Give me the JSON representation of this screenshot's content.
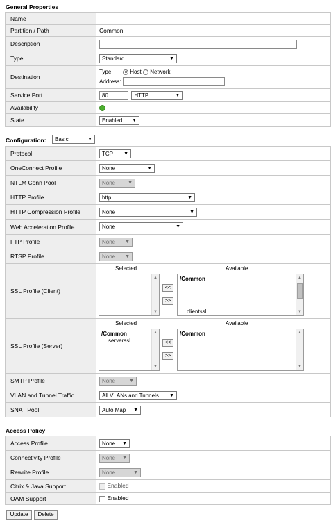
{
  "general": {
    "title": "General Properties",
    "name_label": "Name",
    "partition_label": "Partition / Path",
    "partition_value": "Common",
    "description_label": "Description",
    "type_label": "Type",
    "type_value": "Standard",
    "destination_label": "Destination",
    "dest_type_label": "Type:",
    "dest_host": "Host",
    "dest_network": "Network",
    "dest_address_label": "Address:",
    "service_port_label": "Service Port",
    "service_port_value": "80",
    "service_port_protocol": "HTTP",
    "availability_label": "Availability",
    "state_label": "State",
    "state_value": "Enabled"
  },
  "configuration": {
    "title": "Configuration:",
    "mode": "Basic",
    "protocol_label": "Protocol",
    "protocol_value": "TCP",
    "oneconnect_label": "OneConnect Profile",
    "oneconnect_value": "None",
    "ntlm_label": "NTLM Conn Pool",
    "ntlm_value": "None",
    "http_profile_label": "HTTP Profile",
    "http_profile_value": "http",
    "http_compression_label": "HTTP Compression Profile",
    "http_compression_value": "None",
    "web_accel_label": "Web Acceleration Profile",
    "web_accel_value": "None",
    "ftp_label": "FTP Profile",
    "ftp_value": "None",
    "rtsp_label": "RTSP Profile",
    "rtsp_value": "None",
    "ssl_client_label": "SSL Profile (Client)",
    "ssl_server_label": "SSL Profile (Server)",
    "selected_header": "Selected",
    "available_header": "Available",
    "move_left": "<<",
    "move_right": ">>",
    "ssl_client_available_group": "/Common",
    "ssl_client_available_item": "clientssl",
    "ssl_server_selected_group": "/Common",
    "ssl_server_selected_item": "serverssl",
    "ssl_server_available_group": "/Common",
    "smtp_label": "SMTP Profile",
    "smtp_value": "None",
    "vlan_label": "VLAN and Tunnel Traffic",
    "vlan_value": "All VLANs and Tunnels",
    "snat_label": "SNAT Pool",
    "snat_value": "Auto Map"
  },
  "access": {
    "title": "Access Policy",
    "access_profile_label": "Access Profile",
    "access_profile_value": "None",
    "connectivity_label": "Connectivity Profile",
    "connectivity_value": "None",
    "rewrite_label": "Rewrite Profile",
    "rewrite_value": "None",
    "citrix_label": "Citrix & Java Support",
    "citrix_value": "Enabled",
    "oam_label": "OAM Support",
    "oam_value": "Enabled"
  },
  "buttons": {
    "update": "Update",
    "delete": "Delete"
  },
  "colors": {
    "label_bg": "#eeeeee",
    "border": "#c8c8c8",
    "availability": "#4caf2f"
  }
}
